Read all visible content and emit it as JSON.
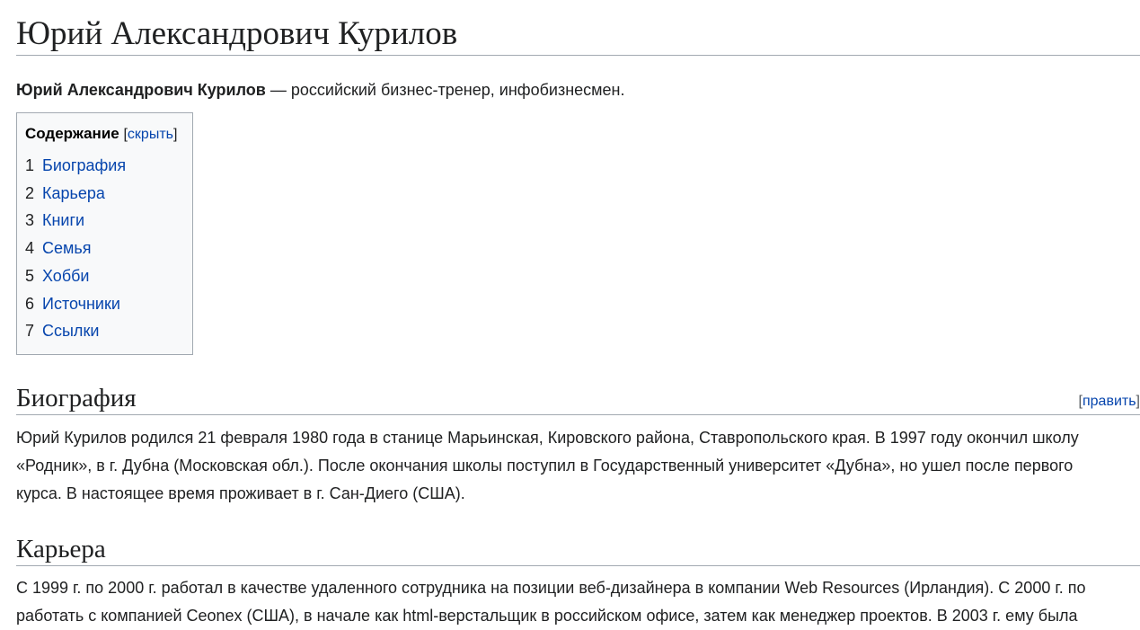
{
  "title": "Юрий Александрович Курилов",
  "lead": {
    "bold": "Юрий Александрович Курилов",
    "rest": " — российский бизнес-тренер, инфобизнесмен."
  },
  "toc": {
    "title": "Содержание",
    "bracket_open": "[",
    "toggle_label": "скрыть",
    "bracket_close": "]",
    "items": [
      {
        "number": "1",
        "label": "Биография"
      },
      {
        "number": "2",
        "label": "Карьера"
      },
      {
        "number": "3",
        "label": "Книги"
      },
      {
        "number": "4",
        "label": "Семья"
      },
      {
        "number": "5",
        "label": "Хобби"
      },
      {
        "number": "6",
        "label": "Источники"
      },
      {
        "number": "7",
        "label": "Ссылки"
      }
    ]
  },
  "sections": {
    "biography": {
      "heading": "Биография",
      "edit_open": "[",
      "edit_label": "править",
      "edit_close": "]",
      "lines": [
        "Юрий Курилов родился 21 февраля 1980 года в станице Марьинская, Кировского района, Ставропольского края. В 1997 году окончил школу",
        "«Родник», в г. Дубна (Московская обл.). После окончания школы поступил в Государственный университет «Дубна», но ушел после первого",
        "курса. В настоящее время проживает в г. Сан-Диего (США)."
      ]
    },
    "career": {
      "heading": "Карьера",
      "lines": [
        "С 1999 г. по 2000 г. работал в качестве удаленного сотрудника на позиции веб-дизайнера в компании Web Resources (Ирландия). С 2000 г. по",
        "работать с компанией Ceonex (США), в начале как html-верстальщик в российском офисе, затем как менеджер проектов. В 2003 г. ему была"
      ]
    }
  }
}
